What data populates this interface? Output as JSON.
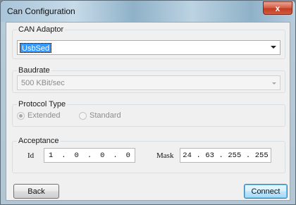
{
  "window": {
    "title": "Can Configuration",
    "close_label": "x"
  },
  "adaptor": {
    "group_label": "CAN Adaptor",
    "selected": "UsbSed"
  },
  "baudrate": {
    "group_label": "Baudrate",
    "selected": "500 KBit/sec"
  },
  "protocol": {
    "group_label": "Protocol Type",
    "options": [
      {
        "label": "Extended",
        "checked": true
      },
      {
        "label": "Standard",
        "checked": false
      }
    ]
  },
  "acceptance": {
    "group_label": "Acceptance",
    "id_label": "Id",
    "id_octets": [
      "1",
      "0",
      "0",
      "0"
    ],
    "mask_label": "Mask",
    "mask_octets": [
      "24",
      "63",
      "255",
      "255"
    ]
  },
  "buttons": {
    "back": "Back",
    "connect": "Connect"
  },
  "colors": {
    "selection": "#3399ff",
    "client_bg": "#f0f0f0",
    "close_red": "#c23d22"
  }
}
